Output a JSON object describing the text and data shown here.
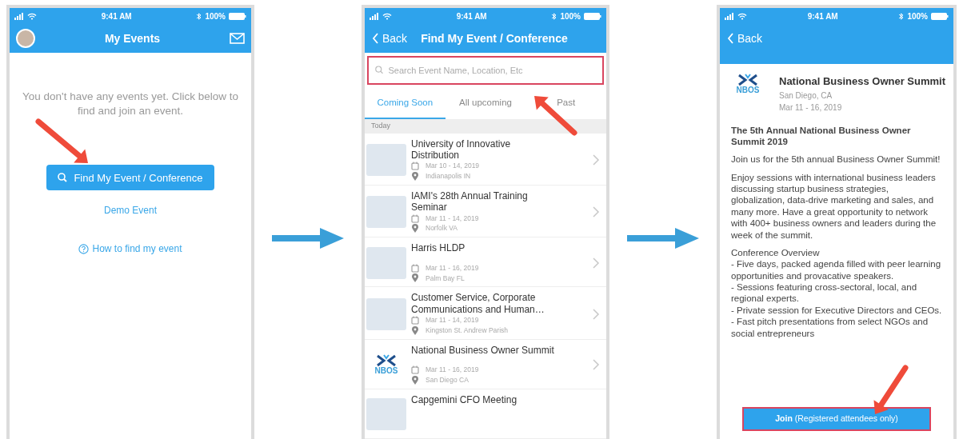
{
  "screen_1": {
    "status_bar": {
      "time": "9:41 AM",
      "battery": "100%"
    },
    "title": "My Events",
    "message": "You don't have any events yet. Click below to find and join an event.",
    "find_button": "Find My Event / Conference",
    "demo_link": "Demo Event",
    "help_link": "How to find my event"
  },
  "screen_2": {
    "status_bar": {
      "time": "9:41 AM",
      "battery": "100%"
    },
    "back": "Back",
    "title": "Find My Event / Conference",
    "search": {
      "placeholder": "Search Event Name, Location, Etc"
    },
    "tabs": [
      {
        "label": "Coming Soon",
        "selected": true
      },
      {
        "label": "All upcoming",
        "selected": false
      },
      {
        "label": "Past",
        "selected": false
      }
    ],
    "section": "Today",
    "events": [
      {
        "title": "University of Innovative Distribution",
        "dates": "Mar 10 - 14, 2019",
        "location": "Indianapolis IN"
      },
      {
        "title": "IAMI's 28th Annual Training Seminar",
        "dates": "Mar 11 - 14, 2019",
        "location": "Norfolk VA"
      },
      {
        "title": "Harris HLDP",
        "dates": "Mar 11 - 16, 2019",
        "location": "Palm Bay FL"
      },
      {
        "title": "Customer Service, Corporate Communications and Human…",
        "dates": "Mar 11 - 14, 2019",
        "location": "Kingston St. Andrew Parish"
      },
      {
        "title": "National Business Owner Summit",
        "logo_text": "NBOS",
        "dates": "Mar 11 - 16, 2019",
        "location": "San Diego CA"
      },
      {
        "title": "Capgemini CFO Meeting"
      }
    ]
  },
  "screen_3": {
    "status_bar": {
      "time": "9:41 AM",
      "battery": "100%"
    },
    "back": "Back",
    "event": {
      "title": "National Business Owner Summit",
      "logo_text": "NBOS",
      "location": "San Diego, CA",
      "dates": "Mar 11 - 16, 2019"
    },
    "heading": "The 5th Annual National Business Owner Summit 2019",
    "paragraphs": [
      "Join us for the 5th annual Business Owner Summit!",
      "Enjoy sessions with international business leaders discussing startup business strategies, globalization, data-drive marketing and sales, and many more. Have a great opportunity to network with 400+ business owners and leaders during the week of the summit."
    ],
    "overview": [
      "Conference Overview",
      "- Five days, packed agenda filled with peer learning opportunities and provacative speakers.",
      "- Sessions featuring cross-sectoral, local, and regional experts.",
      "- Private session for Executive Directors and CEOs.",
      "- Fast pitch presentations from select NGOs and social entrepreneurs"
    ],
    "join_button": "**Join** (Registered attendees only)"
  }
}
